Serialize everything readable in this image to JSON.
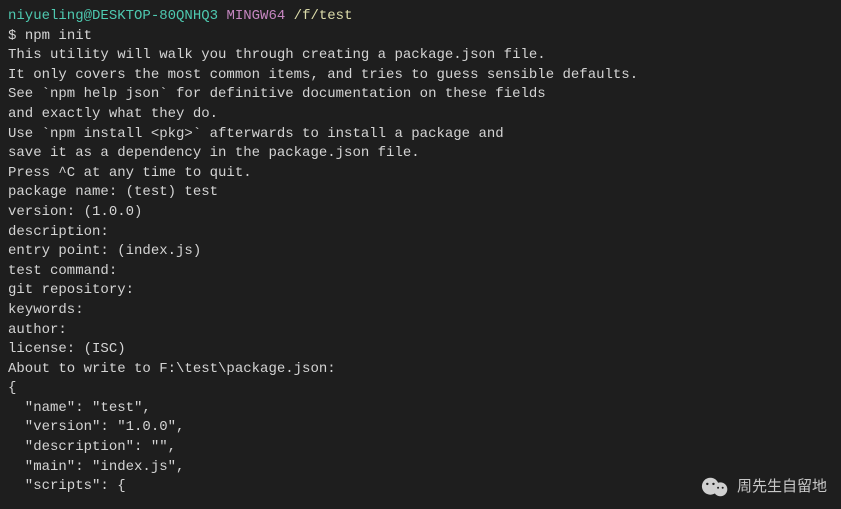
{
  "prompt": {
    "user": "niyueling@DESKTOP-80QNHQ3",
    "env": "MINGW64",
    "path": "/f/test",
    "sym": "$",
    "cmd": "npm init"
  },
  "out": {
    "l1": "This utility will walk you through creating a package.json file.",
    "l2": "It only covers the most common items, and tries to guess sensible defaults.",
    "blank1": "",
    "l3": "See `npm help json` for definitive documentation on these fields",
    "l4": "and exactly what they do.",
    "blank2": "",
    "l5": "Use `npm install <pkg>` afterwards to install a package and",
    "l6": "save it as a dependency in the package.json file.",
    "blank3": "",
    "l7": "Press ^C at any time to quit.",
    "l8": "package name: (test) test",
    "l9": "version: (1.0.0)",
    "l10": "description:",
    "l11": "entry point: (index.js)",
    "l12": "test command:",
    "l13": "git repository:",
    "l14": "keywords:",
    "l15": "author:",
    "l16": "license: (ISC)",
    "l17": "About to write to F:\\test\\package.json:",
    "blank4": "",
    "j1": "{",
    "j2": "  \"name\": \"test\",",
    "j3": "  \"version\": \"1.0.0\",",
    "j4": "  \"description\": \"\",",
    "j5": "  \"main\": \"index.js\",",
    "j6": "  \"scripts\": {"
  },
  "watermark": {
    "text": "周先生自留地"
  }
}
